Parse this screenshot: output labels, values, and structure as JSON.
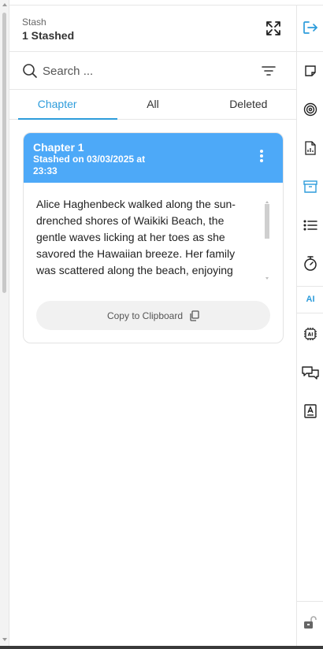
{
  "header": {
    "title": "Stash",
    "count_label": "1 Stashed",
    "expand_icon": "expand-icon"
  },
  "search": {
    "placeholder": "Search ...",
    "value": "",
    "icon": "search-icon",
    "filter_icon": "filter-icon"
  },
  "tabs": [
    {
      "label": "Chapter",
      "active": true
    },
    {
      "label": "All",
      "active": false
    },
    {
      "label": "Deleted",
      "active": false
    }
  ],
  "card": {
    "title": "Chapter 1",
    "subtitle": "Stashed on 03/03/2025 at 23:33",
    "body": "Alice Haghenbeck walked along the sun-drenched shores of Waikiki Beach, the gentle waves licking at her toes as she savored the Hawaiian breeze. Her family was scattered along the beach, enjoying their time vacationing, but Alice hesitat",
    "copy_label": "Copy to Clipboard",
    "header_color": "#4da9f8"
  },
  "toolbar": {
    "items": [
      "logout-icon",
      "sticky-note-icon",
      "target-icon",
      "report-icon",
      "archive-icon",
      "list-icon",
      "timer-icon",
      "ai-icon",
      "ai-chip-icon",
      "chat-icon",
      "text-box-icon",
      "lock-icon"
    ],
    "ai_label": "AI",
    "accent": "#2d9cdb"
  }
}
